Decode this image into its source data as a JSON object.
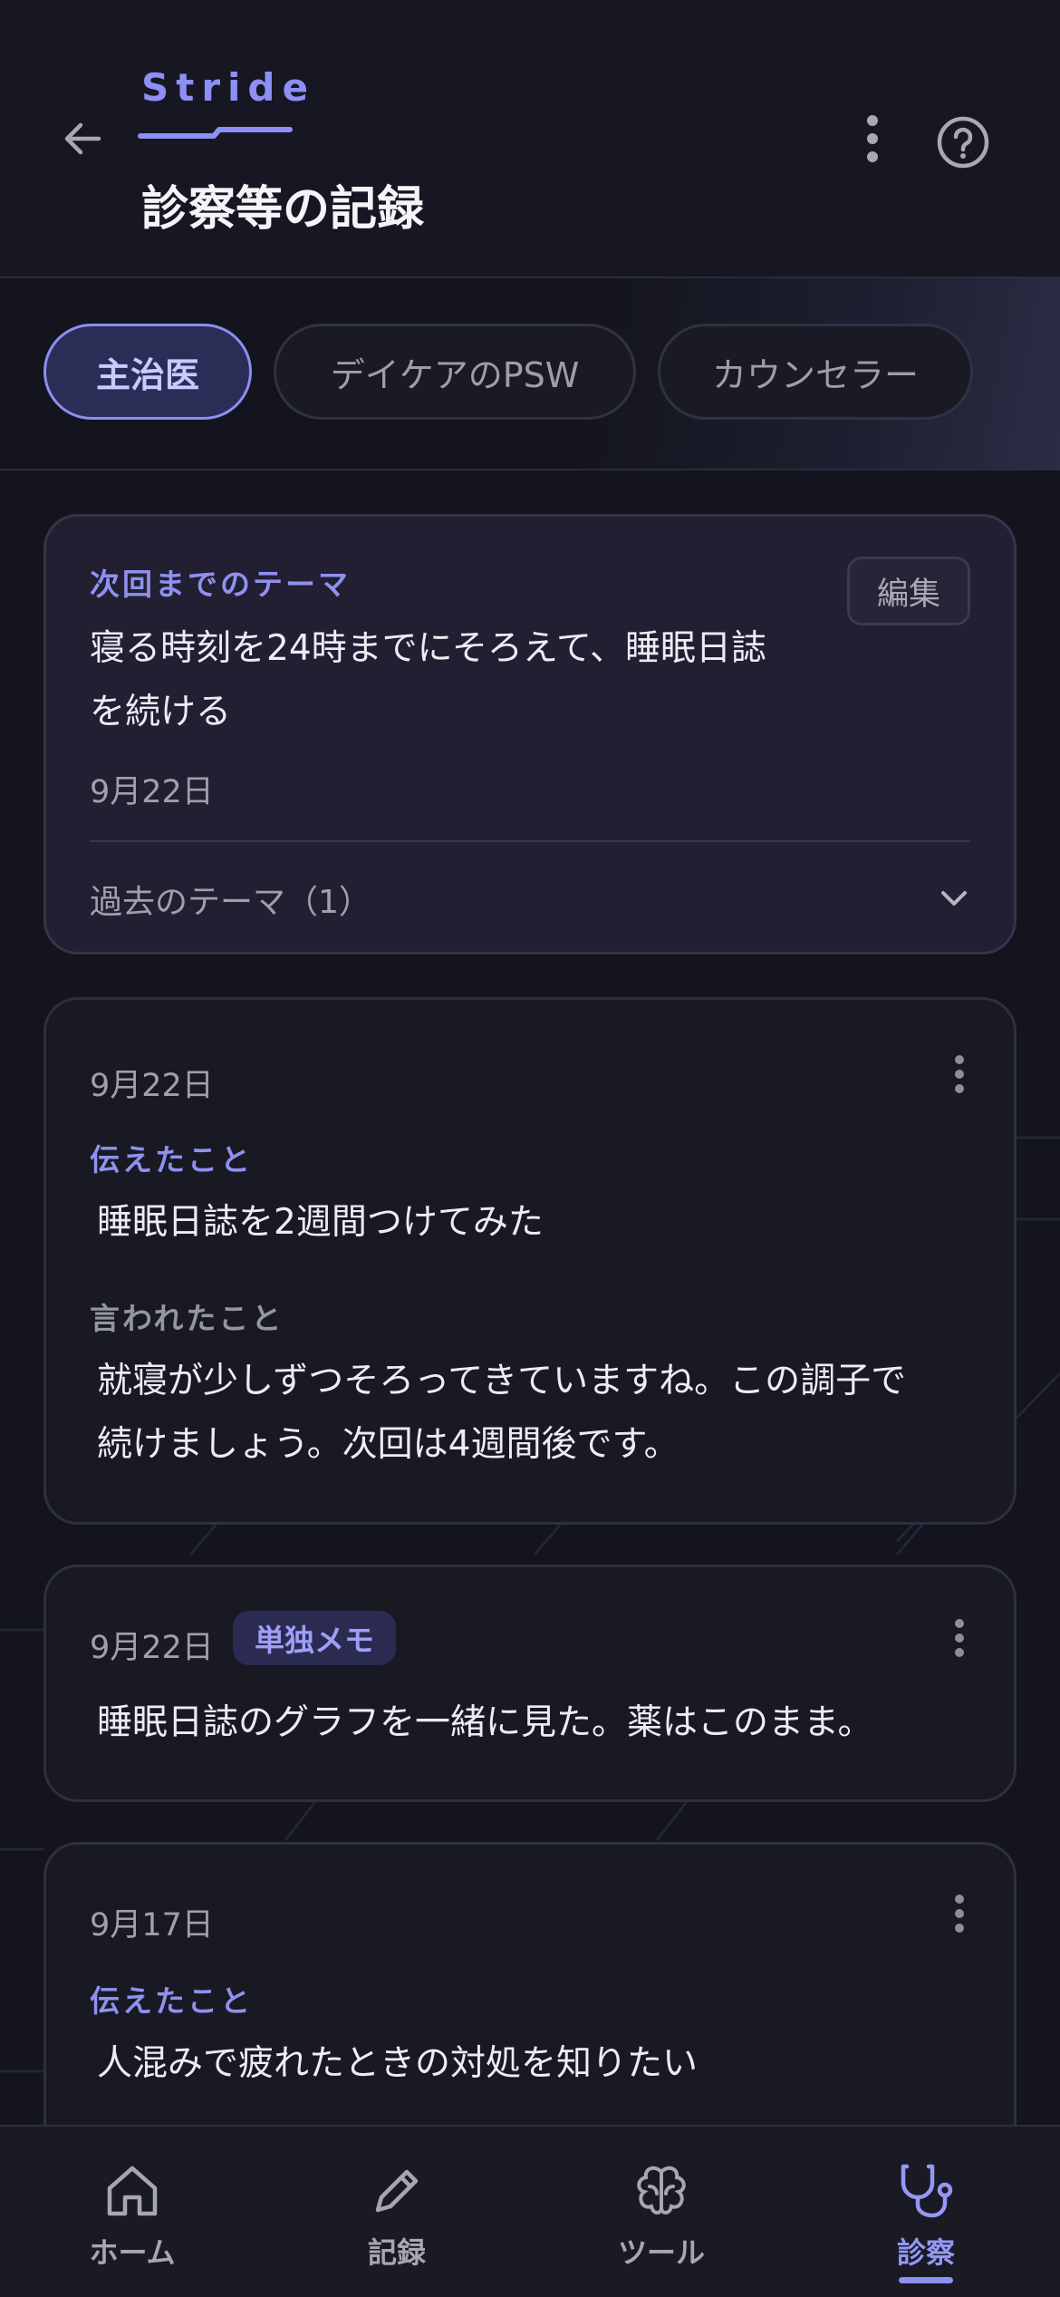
{
  "header": {
    "brand": "Stride",
    "title": "診察等の記録"
  },
  "tabs": [
    {
      "label": "主治医",
      "active": true
    },
    {
      "label": "デイケアのPSW",
      "active": false
    },
    {
      "label": "カウンセラー",
      "active": false
    }
  ],
  "theme_card": {
    "label": "次回までのテーマ",
    "edit_label": "編集",
    "text_line1": "寝る時刻を24時までにそろえて、睡眠日誌",
    "text_line2": "を続ける",
    "date": "9月22日",
    "past_label": "過去のテーマ（1）"
  },
  "records": [
    {
      "date": "9月22日",
      "told_label": "伝えたこと",
      "told": "睡眠日誌を2週間つけてみた",
      "said_label": "言われたこと",
      "said_line1": "就寝が少しずつそろってきていますね。この調子で",
      "said_line2": "続けましょう。次回は4週間後です。"
    },
    {
      "date": "9月22日",
      "badge": "単独メモ",
      "memo": "睡眠日誌のグラフを一緒に見た。薬はこのまま。"
    },
    {
      "date": "9月17日",
      "told_label": "伝えたこと",
      "told": "人混みで疲れたときの対処を知りたい"
    }
  ],
  "bottom_nav": [
    {
      "label": "ホーム",
      "icon": "home-icon",
      "active": false
    },
    {
      "label": "記録",
      "icon": "pencil-icon",
      "active": false
    },
    {
      "label": "ツール",
      "icon": "brain-icon",
      "active": false
    },
    {
      "label": "診察",
      "icon": "stethoscope-icon",
      "active": true
    }
  ],
  "colors": {
    "accent": "#8f91f0",
    "background": "#13141d",
    "card": "#181923",
    "theme_card": "#221f33"
  }
}
